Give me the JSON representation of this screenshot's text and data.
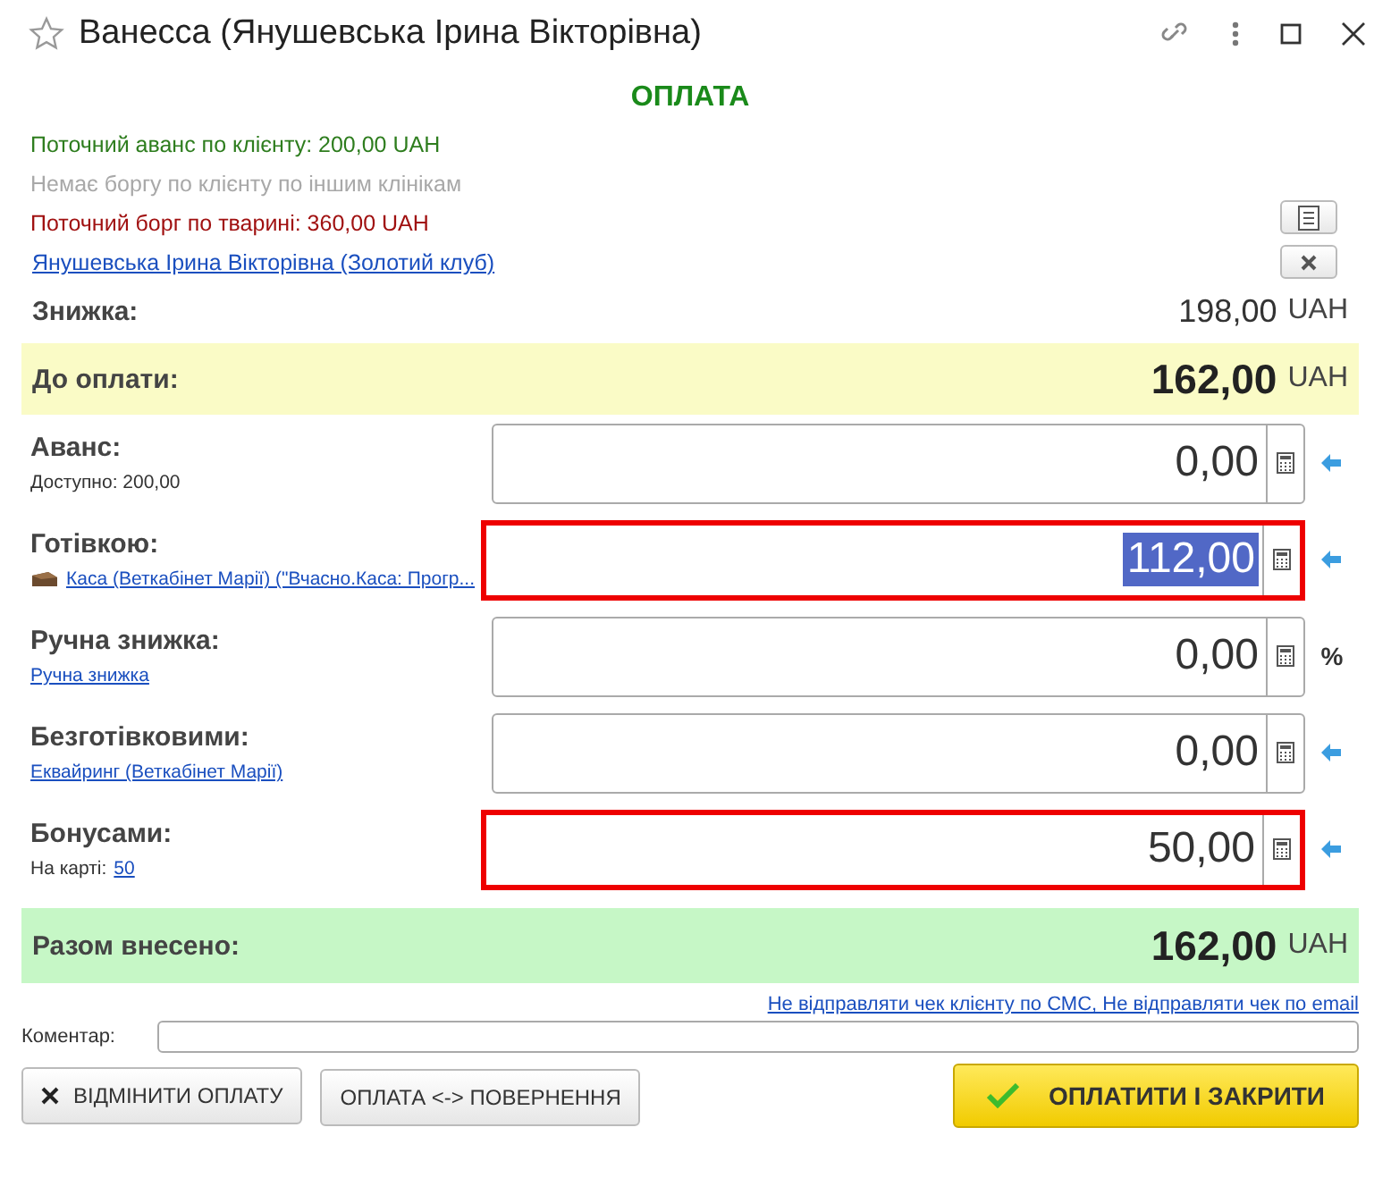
{
  "window": {
    "title": "Ванесса (Янушевська Ірина Вікторівна)",
    "favorite": false
  },
  "heading": "ОПЛАТА",
  "info_lines": [
    {
      "text": "Поточний аванс по клієнту: 200,00 UAH",
      "color": "#2e7d1e"
    },
    {
      "text": "Немає боргу по клієнту по іншим клінікам",
      "color": "#a8a8a8"
    },
    {
      "text": "Поточний борг по тварині: 360,00 UAH",
      "color": "#a01010"
    }
  ],
  "client_link": "Янушевська Ірина Вікторівна (Золотий клуб)",
  "discount": {
    "label": "Знижка:",
    "amount": "198,00",
    "currency": "UAH"
  },
  "to_pay": {
    "label": "До оплати:",
    "amount": "162,00",
    "currency": "UAH"
  },
  "payments": [
    {
      "label": "Аванс:",
      "sub": [
        {
          "kind": "text",
          "text": "Доступно: 200,00"
        }
      ],
      "value": "0,00",
      "highlighted": false,
      "selected": false,
      "side": {
        "kind": "arrow"
      }
    },
    {
      "label": "Готівкою:",
      "sub": [
        {
          "kind": "cash_link",
          "text": "Каса (Веткабінет Марії) (\"Вчасно.Каса: Прогр..."
        }
      ],
      "value": "112,00",
      "highlighted": true,
      "selected": true,
      "side": {
        "kind": "arrow"
      }
    },
    {
      "label": "Ручна знижка:",
      "sub": [
        {
          "kind": "link",
          "text": "Ручна знижка"
        }
      ],
      "value": "0,00",
      "highlighted": false,
      "selected": false,
      "side": {
        "kind": "text",
        "text": "%"
      }
    },
    {
      "label": "Безготівковими:",
      "sub": [
        {
          "kind": "link",
          "text": "Еквайринг (Веткабінет Марії)"
        }
      ],
      "value": "0,00",
      "highlighted": false,
      "selected": false,
      "side": {
        "kind": "arrow"
      }
    },
    {
      "label": "Бонусами:",
      "sub": [
        {
          "kind": "text",
          "text": "На карті:"
        },
        {
          "kind": "link",
          "text": "50"
        }
      ],
      "value": "50,00",
      "highlighted": true,
      "selected": false,
      "side": {
        "kind": "arrow"
      }
    }
  ],
  "total": {
    "label": "Разом внесено:",
    "amount": "162,00",
    "currency": "UAH"
  },
  "receipt_link": "Не відправляти чек клієнту по СМС, Не відправляти чек по email",
  "comment": {
    "label": "Коментар:"
  },
  "buttons": [
    {
      "kind": "cancel",
      "label": "ВІДМІНИТИ ОПЛАТУ"
    },
    {
      "kind": "plain",
      "label": "ОПЛАТА <-> ПОВЕРНЕННЯ"
    },
    {
      "kind": "primary",
      "label": "ОПЛАТИТИ І ЗАКРИТИ"
    }
  ]
}
